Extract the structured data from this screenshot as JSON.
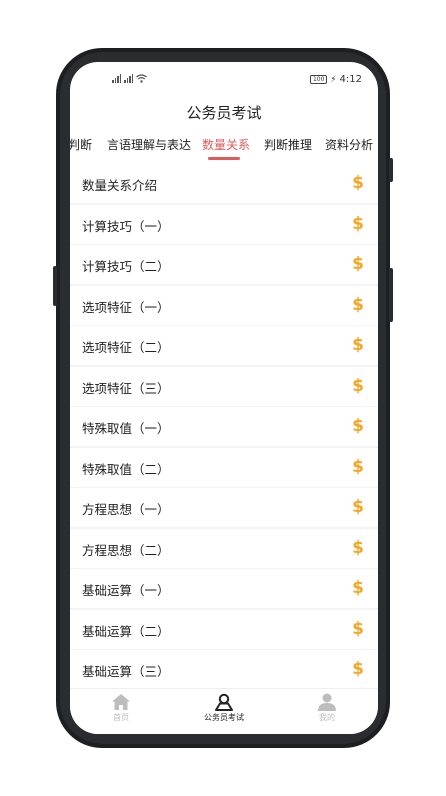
{
  "status_bar": {
    "signal_1": "..ll",
    "signal_2": "..ll",
    "battery": "100",
    "time": "4:12"
  },
  "app_title": "公务员考试",
  "tabs": [
    {
      "label": "判断"
    },
    {
      "label": "言语理解与表达"
    },
    {
      "label": "数量关系",
      "active": true
    },
    {
      "label": "判断推理"
    },
    {
      "label": "资料分析"
    }
  ],
  "items": [
    {
      "label": "数量关系介绍",
      "icon": "dollar-icon"
    },
    {
      "label": "计算技巧（一）",
      "icon": "dollar-icon"
    },
    {
      "label": "计算技巧（二）",
      "icon": "dollar-icon"
    },
    {
      "label": "选项特征（一）",
      "icon": "dollar-icon"
    },
    {
      "label": "选项特征（二）",
      "icon": "dollar-icon"
    },
    {
      "label": "选项特征（三）",
      "icon": "dollar-icon"
    },
    {
      "label": "特殊取值（一）",
      "icon": "dollar-icon"
    },
    {
      "label": "特殊取值（二）",
      "icon": "dollar-icon"
    },
    {
      "label": "方程思想（一）",
      "icon": "dollar-icon"
    },
    {
      "label": "方程思想（二）",
      "icon": "dollar-icon"
    },
    {
      "label": "基础运算（一）",
      "icon": "dollar-icon"
    },
    {
      "label": "基础运算（二）",
      "icon": "dollar-icon"
    },
    {
      "label": "基础运算（三）",
      "icon": "dollar-icon"
    }
  ],
  "coin_symbol": "$",
  "bottom_nav": [
    {
      "label": "首页",
      "icon": "home-icon"
    },
    {
      "label": "公务员考试",
      "icon": "exam-icon",
      "active": true
    },
    {
      "label": "我的",
      "icon": "profile-icon"
    }
  ],
  "colors": {
    "accent": "#e05a5a",
    "coin": "#f5a623"
  }
}
